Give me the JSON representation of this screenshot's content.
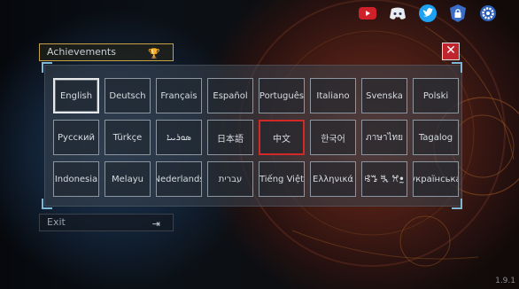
{
  "top_icons": [
    {
      "name": "youtube-icon",
      "color": "#d0202a"
    },
    {
      "name": "discord-icon",
      "color": "#5865f2"
    },
    {
      "name": "twitter-icon",
      "color": "#1da1f2"
    },
    {
      "name": "lock-icon",
      "color": "#3a6cc8"
    },
    {
      "name": "gear-icon",
      "color": "#3a6cc8"
    }
  ],
  "menu": {
    "achievements": "Achievements",
    "exit": "Exit"
  },
  "languages": [
    "English",
    "Deutsch",
    "Français",
    "Español",
    "Português",
    "Italiano",
    "Svenska",
    "Polski",
    "Русский",
    "Türkçe",
    "ܣܘܪܝܝܐ",
    "日本語",
    "中文",
    "한국어",
    "ภาษาไทย",
    "Tagalog",
    "Indonesia",
    "Melayu",
    "Nederlands",
    "עברית",
    "Tiếng Việt",
    "Ελληνικά",
    "ꕙꔤ ꔩ ꕮꔸ",
    "українська"
  ],
  "selected_language": "English",
  "highlighted_language": "中文",
  "close_label": "✕",
  "version": "1.9.1"
}
